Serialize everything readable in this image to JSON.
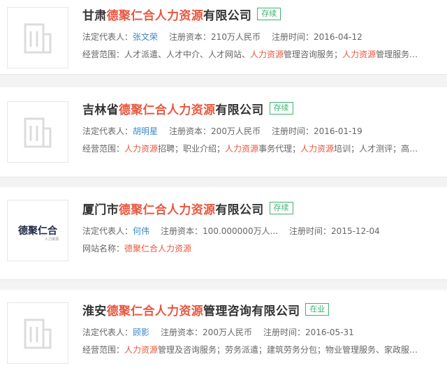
{
  "companies": [
    {
      "name_prefix": "甘肃",
      "name_highlight": "德聚仁合人力资源",
      "name_suffix": "有限公司",
      "status": "存续",
      "legal_rep_label": "法定代表人：",
      "legal_rep": "张文荣",
      "capital_label": "注册资本：",
      "capital": "210万人民币",
      "date_label": "注册时间：",
      "date": "2016-04-12",
      "scope_label": "经营范围：",
      "scope_parts": [
        "人才派遣、人才中介、人才网站、",
        "人力资源",
        "管理咨询服务；",
        "人力资源",
        "管理服务…"
      ]
    },
    {
      "name_prefix": "吉林省",
      "name_highlight": "德聚仁合人力资源",
      "name_suffix": "有限公司",
      "status": "存续",
      "legal_rep_label": "法定代表人：",
      "legal_rep": "胡明星",
      "capital_label": "注册资本：",
      "capital": "200万人民币",
      "date_label": "注册时间：",
      "date": "2016-01-19",
      "scope_label": "经营范围：",
      "scope_parts": [
        "人力资源",
        "招聘；职业介绍；",
        "人力资源",
        "事务代理；",
        "人力资源",
        "培训；人才测评；高…"
      ]
    },
    {
      "name_prefix": "厦门市",
      "name_highlight": "德聚仁合人力资源",
      "name_suffix": "有限公司",
      "status": "存续",
      "legal_rep_label": "法定代表人：",
      "legal_rep": "何伟",
      "capital_label": "注册资本：",
      "capital": "100.000000万人...",
      "date_label": "注册时间：",
      "date": "2015-12-04",
      "website_label": "网站名称：",
      "website": "德聚仁合人力资源",
      "logo_text": "德聚仁合",
      "logo_tiny": "人力资源"
    },
    {
      "name_prefix": "淮安",
      "name_highlight": "德聚仁合人力资源",
      "name_suffix": "管理咨询有限公司",
      "status": "在业",
      "legal_rep_label": "法定代表人：",
      "legal_rep": "顾影",
      "capital_label": "注册资本：",
      "capital": "200万人民币",
      "date_label": "注册时间：",
      "date": "2016-05-31",
      "scope_label": "经营范围：",
      "scope_parts": [
        "人力资源",
        "管理及咨询服务；劳务派遣；建筑劳务分包；物业管理服务、家政服…"
      ]
    }
  ]
}
